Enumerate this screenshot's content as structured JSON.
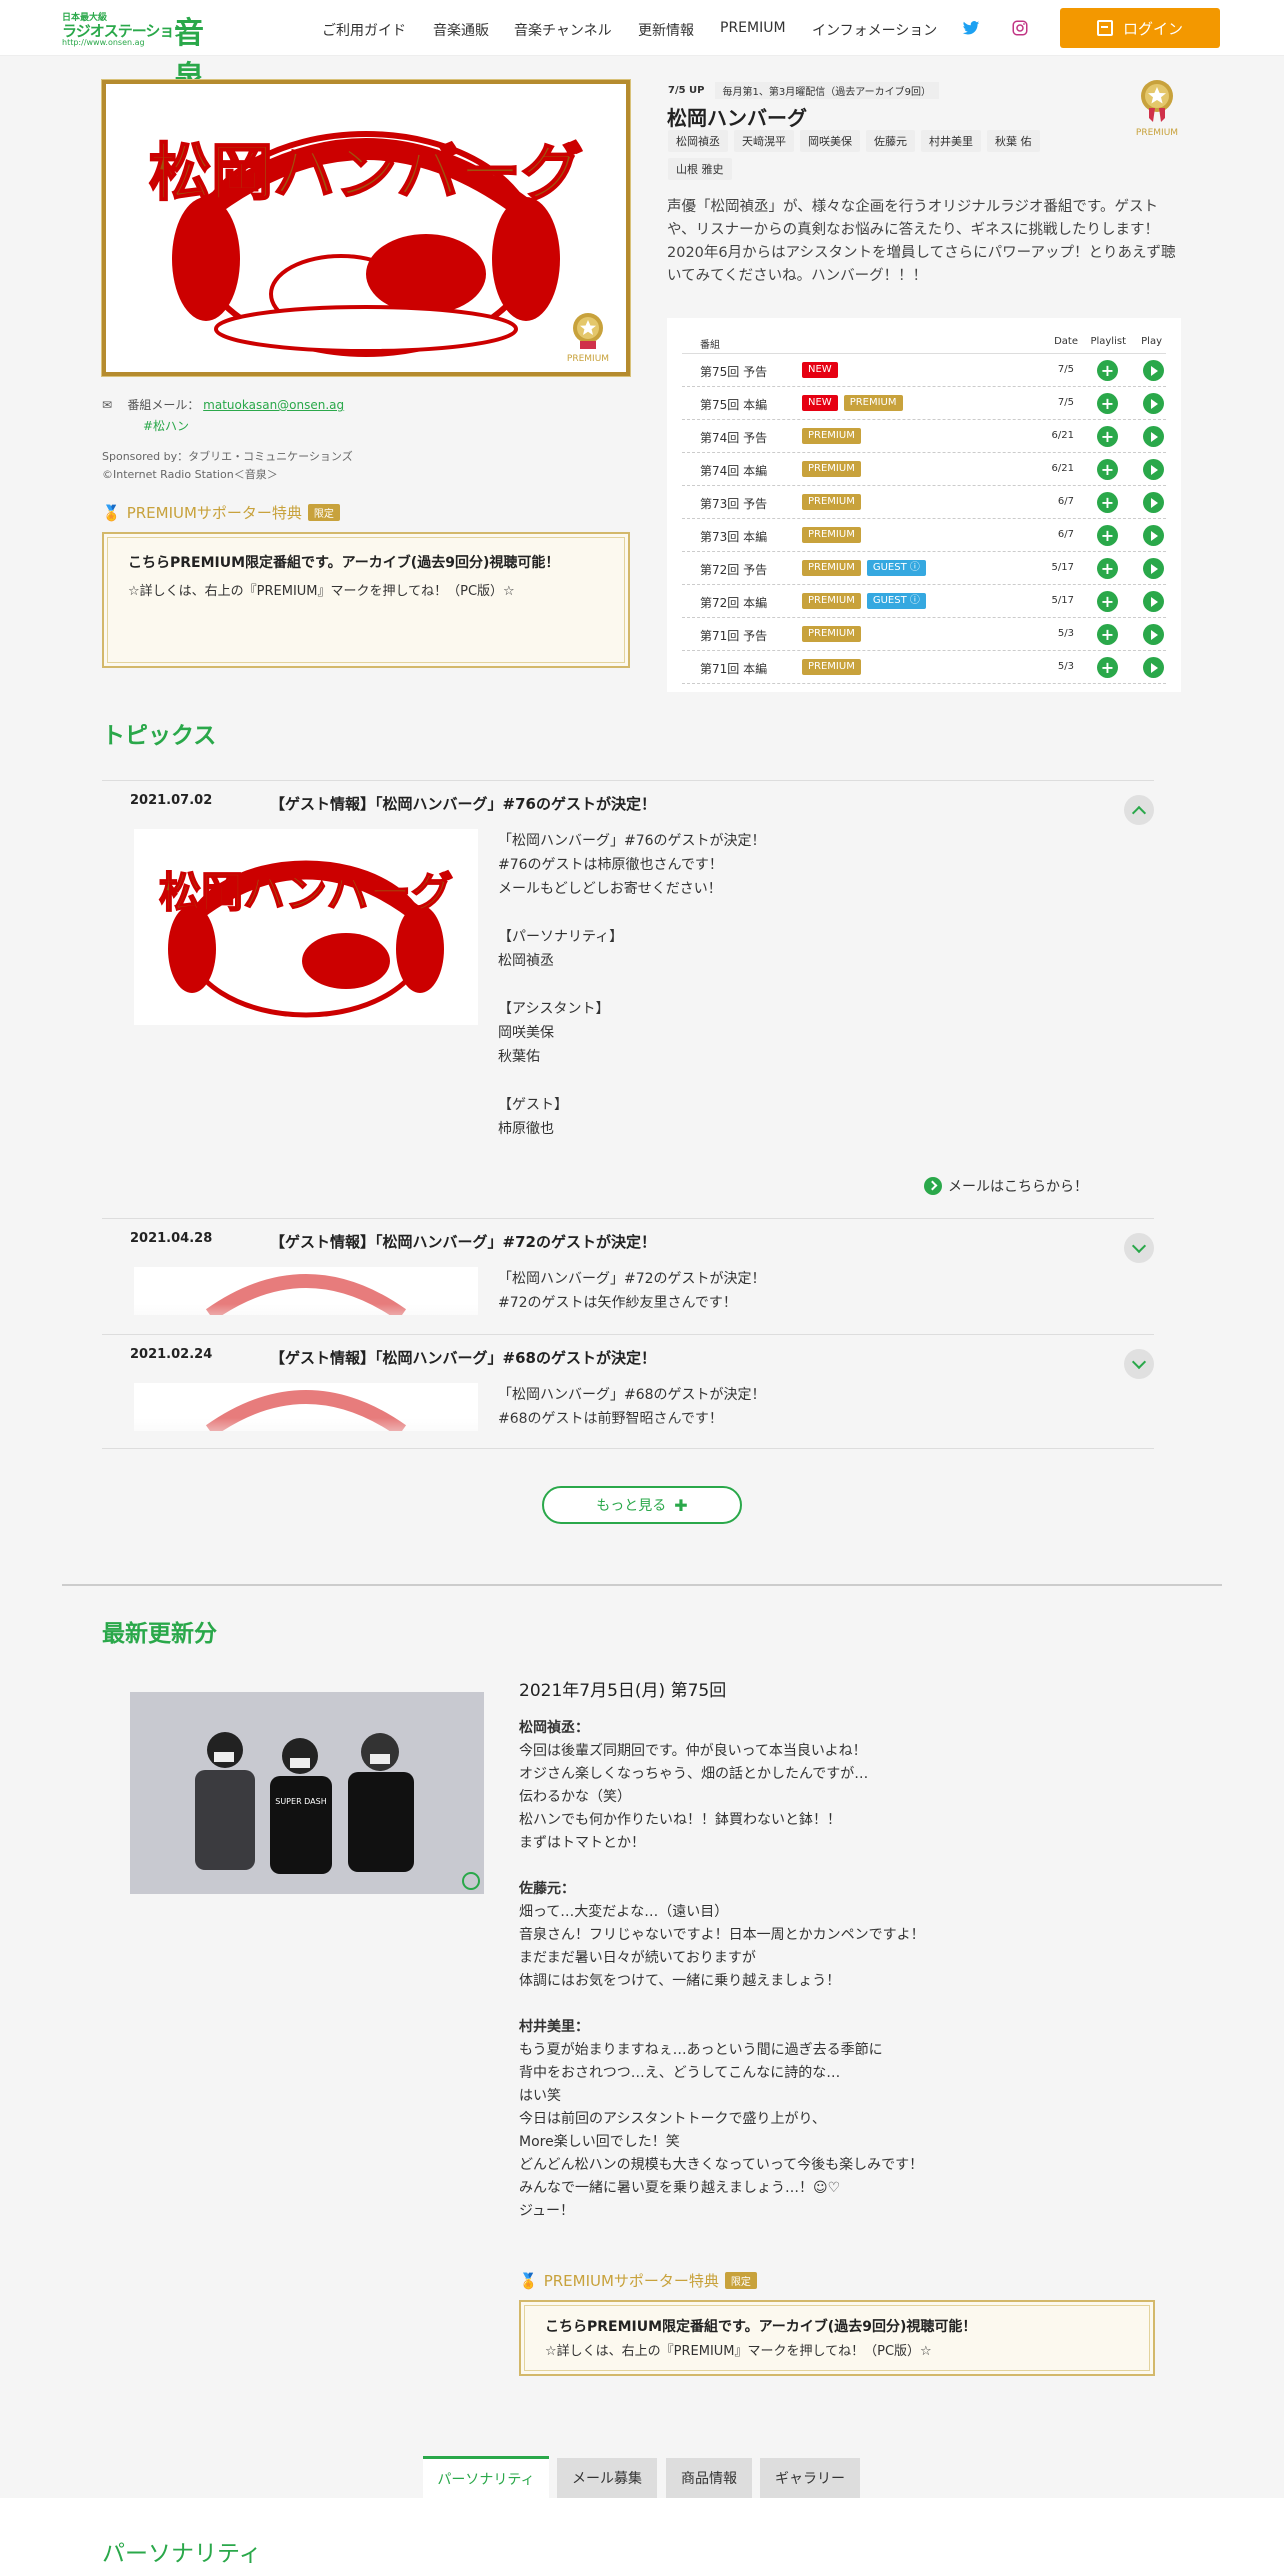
{
  "header": {
    "logo": {
      "small": "日本最大級",
      "mid": "ラジオステーション",
      "url": "http://www.onsen.ag",
      "big": "音泉"
    },
    "nav": [
      "ご利用ガイド",
      "音楽通販",
      "音楽チャンネル",
      "更新情報",
      "PREMIUM",
      "インフォメーション"
    ],
    "login_label": "ログイン"
  },
  "program": {
    "image_title": "松岡ハンバーグ",
    "premium_badge_label": "PREMIUM",
    "update": "7/5 UP",
    "schedule": "毎月第1、第3月曜配信（過去アーカイブ9回）",
    "title": "松岡ハンバーグ",
    "casts": [
      "松岡禎丞",
      "天﨑滉平",
      "岡咲美保",
      "佐藤元",
      "村井美里",
      "秋葉 佑",
      "山根 雅史"
    ],
    "premium_icon_label": "PREMIUM",
    "description": "声優「松岡禎丞」が、様々な企画を行うオリジナルラジオ番組です。ゲストや、リスナーからの真剣なお悩みに答えたり、ギネスに挑戦したりします！2020年6月からはアシスタントを増員してさらにパワーアップ！とりあえず聴いてみてくださいね。ハンバーグ！！！",
    "mail_label": "番組メール：",
    "mail": "matuokasan@onsen.ag",
    "hashtag": "#松ハン",
    "sponsor": "Sponsored by：タブリエ・コミュニケーションズ",
    "copyright": "©Internet Radio Station＜音泉＞"
  },
  "premium_section": {
    "heading": "PREMIUMサポーター特典",
    "limited": "限定",
    "box_title": "こちらPREMIUM限定番組です。アーカイブ(過去9回分)視聴可能！",
    "box_sub": "☆詳しくは、右上の『PREMIUM』マークを押してね！（PC版）☆"
  },
  "episodes": {
    "headers": {
      "title": "番組",
      "date": "Date",
      "playlist": "Playlist",
      "play": "Play"
    },
    "rows": [
      {
        "name": "第75回 予告",
        "tags": [
          "NEW"
        ],
        "date": "7/5"
      },
      {
        "name": "第75回 本編",
        "tags": [
          "NEW",
          "PREMIUM"
        ],
        "date": "7/5"
      },
      {
        "name": "第74回 予告",
        "tags": [
          "PREMIUM"
        ],
        "date": "6/21"
      },
      {
        "name": "第74回 本編",
        "tags": [
          "PREMIUM"
        ],
        "date": "6/21"
      },
      {
        "name": "第73回 予告",
        "tags": [
          "PREMIUM"
        ],
        "date": "6/7"
      },
      {
        "name": "第73回 本編",
        "tags": [
          "PREMIUM"
        ],
        "date": "6/7"
      },
      {
        "name": "第72回 予告",
        "tags": [
          "PREMIUM",
          "GUEST ⓘ"
        ],
        "date": "5/17"
      },
      {
        "name": "第72回 本編",
        "tags": [
          "PREMIUM",
          "GUEST ⓘ"
        ],
        "date": "5/17"
      },
      {
        "name": "第71回 予告",
        "tags": [
          "PREMIUM"
        ],
        "date": "5/3"
      },
      {
        "name": "第71回 本編",
        "tags": [
          "PREMIUM"
        ],
        "date": "5/3"
      }
    ]
  },
  "topics": {
    "heading": "トピックス",
    "items": [
      {
        "date": "2021.07.02",
        "title": "【ゲスト情報】「松岡ハンバーグ」#76のゲストが決定！",
        "body": "「松岡ハンバーグ」#76のゲストが決定！\n#76のゲストは柿原徹也さんです！\nメールもどしどしお寄せください！\n\n【パーソナリティ】\n松岡禎丞\n\n【アシスタント】\n岡咲美保\n秋葉佑\n\n【ゲスト】\n柿原徹也"
      },
      {
        "date": "2021.04.28",
        "title": "【ゲスト情報】「松岡ハンバーグ」#72のゲストが決定！",
        "body": "「松岡ハンバーグ」#72のゲストが決定！\n#72のゲストは矢作紗友里さんです！"
      },
      {
        "date": "2021.02.24",
        "title": "【ゲスト情報】「松岡ハンバーグ」#68のゲストが決定！",
        "body": "「松岡ハンバーグ」#68のゲストが決定！\n#68のゲストは前野智昭さんです！"
      }
    ],
    "mail_link": "メールはこちらから！",
    "more": "もっと見る"
  },
  "latest": {
    "heading": "最新更新分",
    "date_line": "2021年7月5日(月) 第75回",
    "blocks": [
      {
        "name": "松岡禎丞：",
        "text": "今回は後輩ズ同期回です。仲が良いって本当良いよね！\nオジさん楽しくなっちゃう、畑の話とかしたんですが…\n伝わるかな（笑）\n松ハンでも何か作りたいね！！鉢買わないと鉢！！\nまずはトマトとか！"
      },
      {
        "name": "佐藤元：",
        "text": "畑って…大変だよな…（遠い目）\n音泉さん！フリじゃないですよ！日本一周とかカンペンですよ！\nまだまだ暑い日々が続いておりますが\n体調にはお気をつけて、一緒に乗り越えましょう！"
      },
      {
        "name": "村井美里：",
        "text": "もう夏が始まりますねぇ…あっという間に過ぎ去る季節に\n背中をおされつつ…え、どうしてこんなに詩的な…\nはい笑\n今日は前回のアシスタントトークで盛り上がり、\nMore楽しい回でした！笑\nどんどん松ハンの規模も大きくなっていって今後も楽しみです！\nみんなで一緒に暑い夏を乗り越えましょう…！☺♡\nジュー！"
      }
    ],
    "photo_shirt": "SUPER DASH"
  },
  "tabs": [
    "パーソナリティ",
    "メール募集",
    "商品情報",
    "ギャラリー"
  ],
  "personality_heading": "パーソナリティ",
  "colors": {
    "brand_green": "#2aa84a",
    "login_orange": "#f39800",
    "premium_gold": "#c8a23c",
    "new_red": "#e60012",
    "guest_blue": "#35a8e0"
  }
}
